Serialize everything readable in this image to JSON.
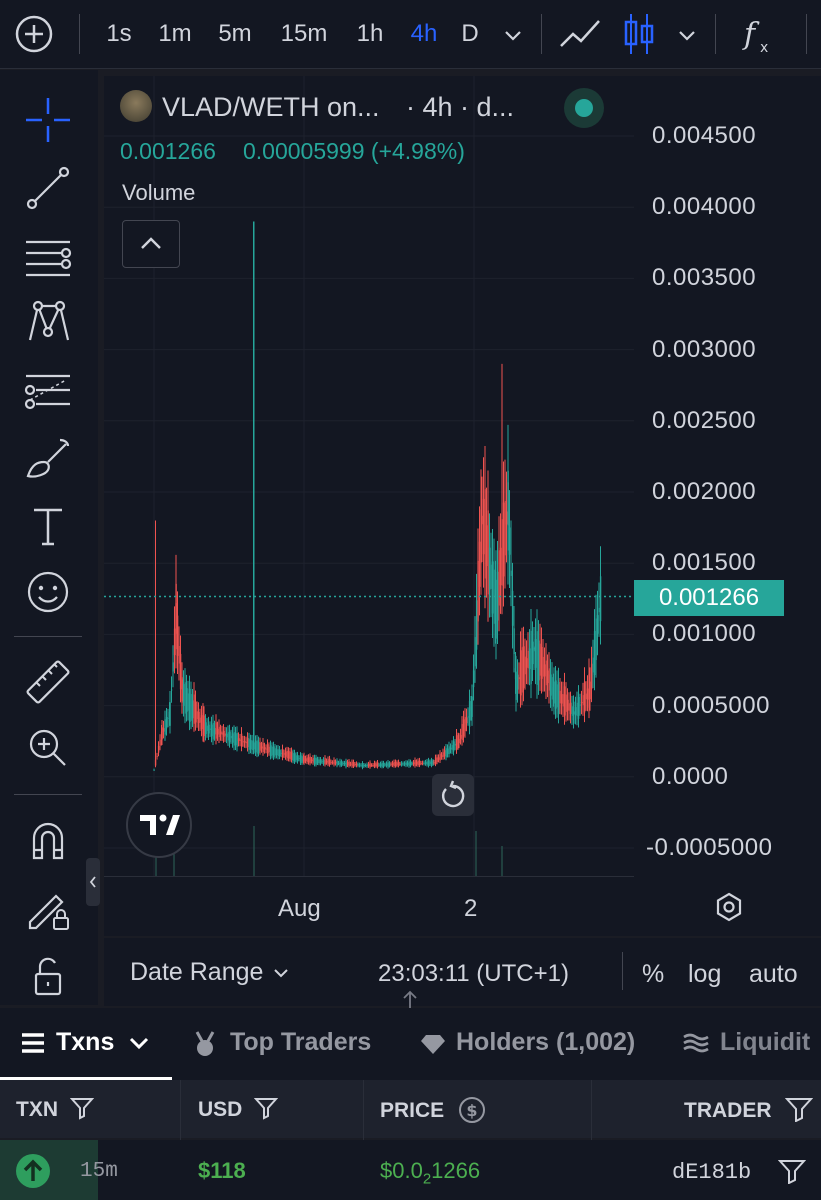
{
  "toolbar": {
    "intervals": [
      "1s",
      "1m",
      "5m",
      "15m",
      "1h",
      "4h",
      "D"
    ],
    "active_interval": "4h"
  },
  "chart": {
    "symbol_title": "VLAD/WETH on...",
    "interval_label": "· 4h · d...",
    "last_price": "0.001266",
    "change": "0.00005999 (+4.98%)",
    "volume_label": "Volume",
    "price_tag": "0.001266",
    "up_color": "#26a69a",
    "down_color": "#ef5350",
    "x_labels": [
      "Aug",
      "2"
    ],
    "y_labels": [
      "0.004500",
      "0.004000",
      "0.003500",
      "0.003000",
      "0.002500",
      "0.002000",
      "0.001500",
      "0.001000",
      "0.0005000",
      "0.0000",
      "-0.0005000"
    ]
  },
  "chart_bar": {
    "date_range": "Date Range",
    "time": "23:03:11 (UTC+1)",
    "percent": "%",
    "log": "log",
    "auto": "auto"
  },
  "tabs": {
    "txns": "Txns",
    "top_traders": "Top Traders",
    "holders": "Holders (1,002)",
    "liquidity": "Liquidit"
  },
  "table": {
    "headers": {
      "txn": "TXN",
      "usd": "USD",
      "price": "PRICE",
      "trader": "TRADER"
    },
    "row": {
      "age": "15m",
      "usd": "$118",
      "price_prefix": "$0.0",
      "price_sub": "2",
      "price_rest": "1266",
      "trader": "dE181b"
    }
  }
}
